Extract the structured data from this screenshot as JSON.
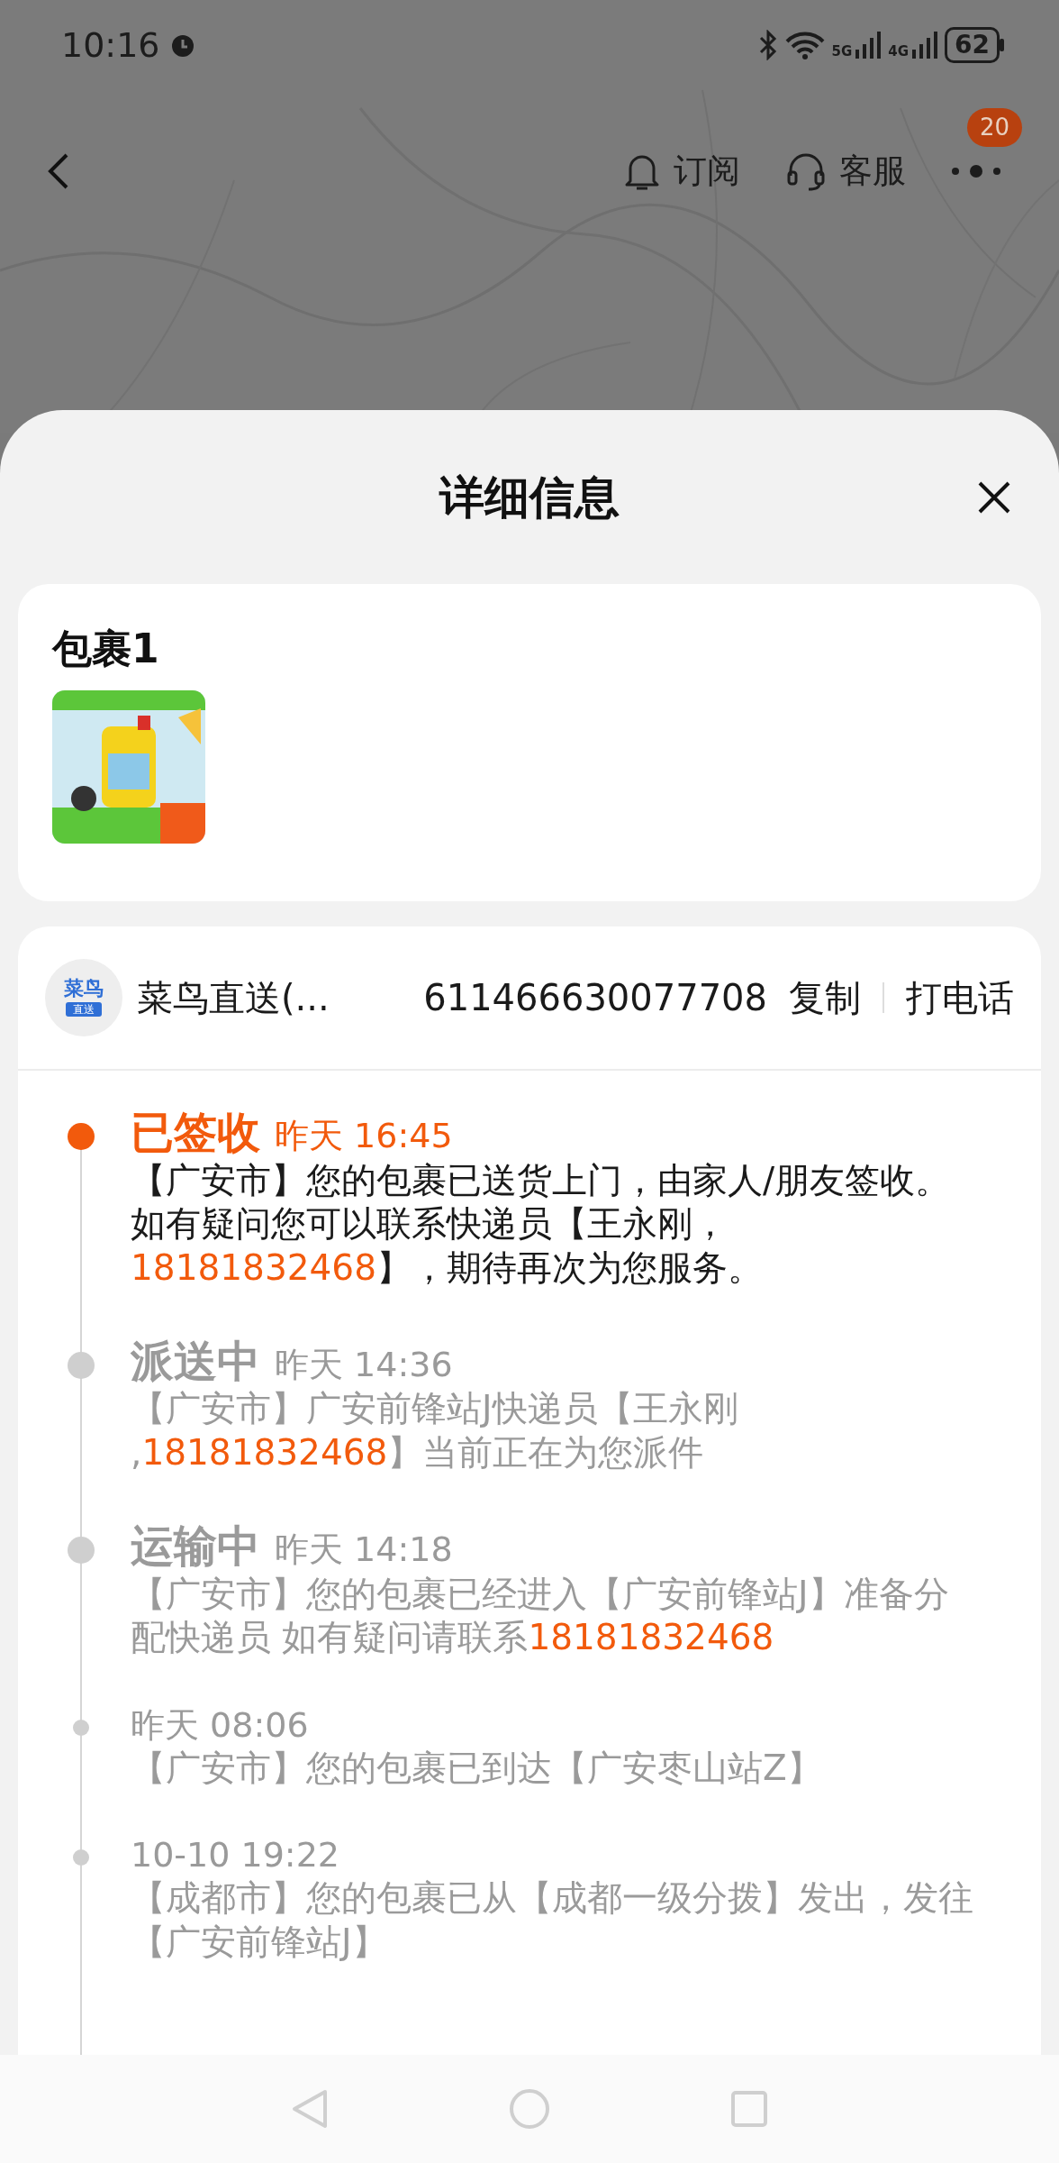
{
  "status_bar": {
    "time": "10:16",
    "network_labels": [
      "5G",
      "4G"
    ],
    "battery": "62"
  },
  "header": {
    "actions": [
      {
        "kind": "bell",
        "label": "订阅"
      },
      {
        "kind": "headset",
        "label": "客服"
      }
    ],
    "more_badge": "20"
  },
  "sheet": {
    "title": "详细信息"
  },
  "package": {
    "title": "包裹1"
  },
  "courier": {
    "logo_text": "菜鸟",
    "logo_tag": "直送",
    "name": "菜鸟直送(...",
    "tracking_number": "611466630077708",
    "copy_label": "复制",
    "call_label": "打电话"
  },
  "timeline": [
    {
      "status": "已签收",
      "time": "昨天 16:45",
      "current": true,
      "segments": [
        {
          "kind": "plain",
          "text": "【广安市】您的包裹已送货上门，由家人/朋友签收。如有疑问您可以联系快递员【王永刚，"
        },
        {
          "kind": "phone",
          "text": "18181832468"
        },
        {
          "kind": "plain",
          "text": "】，期待再次为您服务。"
        }
      ]
    },
    {
      "status": "派送中",
      "time": "昨天 14:36",
      "current": false,
      "segments": [
        {
          "kind": "plain",
          "text": "【广安市】广安前锋站J快递员【王永刚 ,"
        },
        {
          "kind": "phone",
          "text": "18181832468"
        },
        {
          "kind": "plain",
          "text": "】当前正在为您派件"
        }
      ]
    },
    {
      "status": "运输中",
      "time": "昨天 14:18",
      "current": false,
      "segments": [
        {
          "kind": "plain",
          "text": "【广安市】您的包裹已经进入【广安前锋站J】准备分配快递员 如有疑问请联系"
        },
        {
          "kind": "phone",
          "text": "18181832468"
        }
      ]
    },
    {
      "time": "昨天 08:06",
      "current": false,
      "segments": [
        {
          "kind": "plain",
          "text": "【广安市】您的包裹已到达【广安枣山站Z】"
        }
      ]
    },
    {
      "time": "10-10 19:22",
      "current": false,
      "segments": [
        {
          "kind": "plain",
          "text": "【成都市】您的包裹已从【成都一级分拨】发出，发往【广安前锋站J】"
        }
      ]
    }
  ]
}
